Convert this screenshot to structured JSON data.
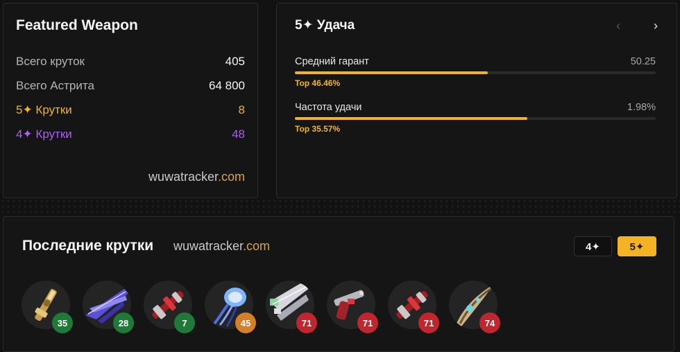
{
  "stats": {
    "title": "Featured Weapon",
    "rows": [
      {
        "label": "Всего круток",
        "value": "405"
      },
      {
        "label": "Всего Астрита",
        "value": "64 800"
      },
      {
        "label": "5✦ Крутки",
        "value": "8"
      },
      {
        "label": "4✦ Крутки",
        "value": "48"
      }
    ],
    "brand_name": "wuwatracker",
    "brand_tld": ".com"
  },
  "luck": {
    "title": "5✦ Удача",
    "metrics": [
      {
        "label": "Средний гарант",
        "value": "50.25",
        "rank": "Top 46.46%",
        "fill_pct": 53.5
      },
      {
        "label": "Частота удачи",
        "value": "1.98%",
        "rank": "Top 35.57%",
        "fill_pct": 64.4
      }
    ]
  },
  "recent": {
    "title": "Последние крутки",
    "brand_name": "wuwatracker",
    "brand_tld": ".com",
    "filters": [
      "4✦",
      "5✦"
    ],
    "pulls": [
      {
        "count": "35",
        "icon": "gold-rifle-weapon-icon",
        "badge_color": "#1f7a3a"
      },
      {
        "count": "28",
        "icon": "blue-sword-weapon-icon",
        "badge_color": "#1f7a3a"
      },
      {
        "count": "7",
        "icon": "red-gauntlet-weapon-icon",
        "badge_color": "#1f7a3a"
      },
      {
        "count": "45",
        "icon": "blue-jellyfish-rectifier-icon",
        "badge_color": "#d47f2a"
      },
      {
        "count": "71",
        "icon": "silver-broadblade-weapon-icon",
        "badge_color": "#c0262d"
      },
      {
        "count": "71",
        "icon": "red-pistol-weapon-icon",
        "badge_color": "#c0262d"
      },
      {
        "count": "71",
        "icon": "red-gauntlet-weapon-icon",
        "badge_color": "#c0262d"
      },
      {
        "count": "74",
        "icon": "gold-blade-weapon-icon",
        "badge_color": "#c0262d"
      }
    ]
  }
}
